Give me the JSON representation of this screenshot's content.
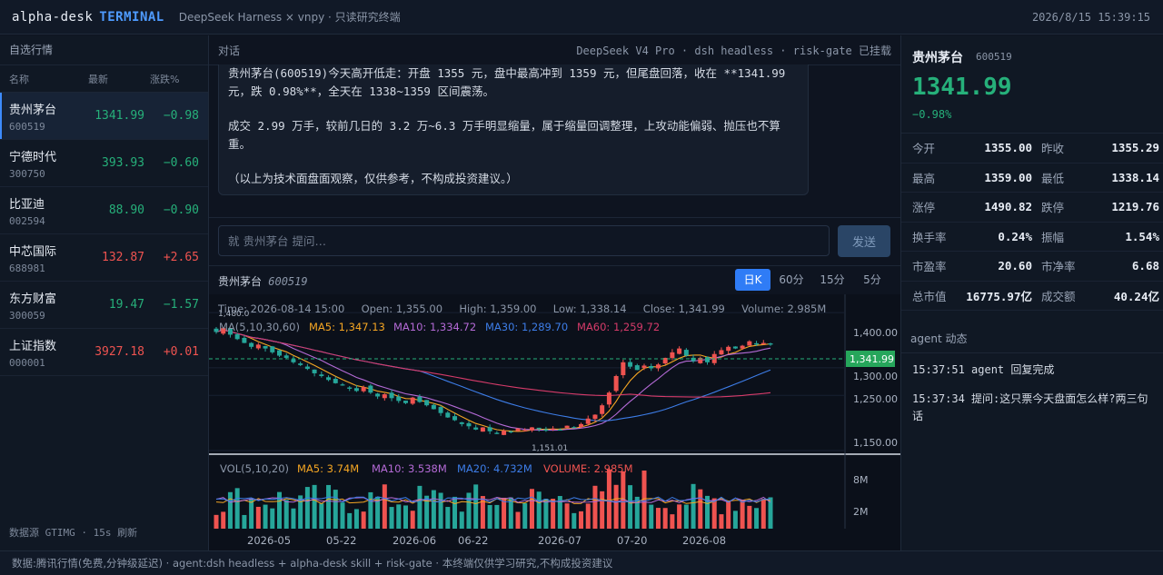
{
  "topbar": {
    "brand": "alpha-desk",
    "brand_accent": "TERMINAL",
    "subtitle": "DeepSeek Harness × vnpy · 只读研究终端",
    "clock": "2026/8/15 15:39:15"
  },
  "watchlist": {
    "title": "自选行情",
    "headers": {
      "name": "名称",
      "last": "最新",
      "pct": "涨跌%"
    },
    "items": [
      {
        "name": "贵州茅台",
        "code": "600519",
        "last": "1341.99",
        "pct": "−0.98",
        "dir": "dn",
        "active": true
      },
      {
        "name": "宁德时代",
        "code": "300750",
        "last": "393.93",
        "pct": "−0.60",
        "dir": "dn"
      },
      {
        "name": "比亚迪",
        "code": "002594",
        "last": "88.90",
        "pct": "−0.90",
        "dir": "dn"
      },
      {
        "name": "中芯国际",
        "code": "688981",
        "last": "132.87",
        "pct": "+2.65",
        "dir": "up"
      },
      {
        "name": "东方财富",
        "code": "300059",
        "last": "19.47",
        "pct": "−1.57",
        "dir": "dn"
      },
      {
        "name": "上证指数",
        "code": "000001",
        "last": "3927.18",
        "pct": "+0.01",
        "dir": "up"
      }
    ],
    "footer": "数据源 GTIMG · 15s 刷新"
  },
  "chat": {
    "title": "对话",
    "model_info": "DeepSeek V4 Pro · dsh headless · risk-gate 已挂载",
    "message_lines": [
      "贵州茅台(600519)今天高开低走：开盘 1355 元，盘中最高冲到 1359 元，但尾盘回落，收在 **1341.99 元，跌 0.98%**，全天在 1338~1359 区间震荡。",
      "成交 2.99 万手，较前几日的 3.2 万~6.3 万手明显缩量，属于缩量回调整理，上攻动能偏弱、抛压也不算重。",
      "（以上为技术面盘面观察，仅供参考，不构成投资建议。）"
    ],
    "input_placeholder": "就 贵州茅台 提问…",
    "send_label": "发送"
  },
  "chart": {
    "symbol_name": "贵州茅台",
    "symbol_code": "600519",
    "timeframes": [
      "日K",
      "60分",
      "15分",
      "5分"
    ],
    "active_timeframe": "日K",
    "info_line": "Time: 2026-08-14 15:00     Open: 1,355.00     High: 1,359.00     Low: 1,338.14     Close: 1,341.99     Volume: 2.985M",
    "ma_legend": {
      "label": "MA(5,10,30,60)",
      "ma5": "MA5: 1,347.13",
      "ma10": "MA10: 1,334.72",
      "ma30": "MA30: 1,289.70",
      "ma60": "MA60: 1,259.72"
    },
    "vol_legend": {
      "label": "VOL(5,10,20)",
      "ma5": "MA5: 3.74M",
      "ma10": "MA10: 3.538M",
      "ma20": "MA20: 4.732M",
      "volume": "VOLUME: 2.985M"
    },
    "price_ticks": [
      "1,400.00",
      "1,300.00",
      "1,250.00",
      "1,150.00"
    ],
    "last_price_label": "1,341.99",
    "high_marker": "1,480.0",
    "low_marker": "1,151.01",
    "vol_ticks": [
      "8M",
      "2M"
    ],
    "date_ticks": [
      "2026-05",
      "05-22",
      "2026-06",
      "06-22",
      "2026-07",
      "07-20",
      "2026-08"
    ],
    "colors": {
      "up": "#ef5350",
      "down": "#26a69a",
      "ma5": "#f5a623",
      "ma10": "#b46ad6",
      "ma30": "#3d7de8",
      "ma60": "#d63b6a"
    }
  },
  "chart_data": {
    "type": "candlestick",
    "title": "贵州茅台 600519 日K",
    "x_range": [
      "2026-04-22",
      "2026-08-14"
    ],
    "ylim": [
      1150,
      1420
    ],
    "close_path": [
      1365,
      1372,
      1360,
      1352,
      1345,
      1338,
      1342,
      1335,
      1328,
      1322,
      1318,
      1310,
      1305,
      1298,
      1290,
      1285,
      1278,
      1272,
      1268,
      1262,
      1258,
      1265,
      1255,
      1248,
      1252,
      1245,
      1240,
      1236,
      1246,
      1238,
      1232,
      1225,
      1218,
      1210,
      1205,
      1198,
      1194,
      1188,
      1192,
      1185,
      1180,
      1186,
      1183,
      1190,
      1187,
      1192,
      1189,
      1186,
      1190,
      1188,
      1195,
      1192,
      1198,
      1208,
      1215,
      1232,
      1255,
      1285,
      1310,
      1302,
      1296,
      1304,
      1299,
      1306,
      1318,
      1328,
      1335,
      1322,
      1312,
      1318,
      1310,
      1325,
      1332,
      1338,
      1335,
      1340,
      1348,
      1342,
      1345,
      1341.99
    ],
    "last": {
      "time": "2026-08-14 15:00",
      "open": 1355.0,
      "high": 1359.0,
      "low": 1338.14,
      "close": 1341.99,
      "volume": "2.985M"
    },
    "ma": {
      "MA5": 1347.13,
      "MA10": 1334.72,
      "MA30": 1289.7,
      "MA60": 1259.72
    },
    "volume_ma": {
      "MA5": "3.74M",
      "MA10": "3.538M",
      "MA20": "4.732M"
    }
  },
  "quote": {
    "name": "贵州茅台",
    "code": "600519",
    "last": "1341.99",
    "pct": "−0.98%",
    "rows": [
      {
        "l1": "今开",
        "v1": "1355.00",
        "l2": "昨收",
        "v2": "1355.29"
      },
      {
        "l1": "最高",
        "v1": "1359.00",
        "l2": "最低",
        "v2": "1338.14"
      },
      {
        "l1": "涨停",
        "v1": "1490.82",
        "l2": "跌停",
        "v2": "1219.76"
      },
      {
        "l1": "换手率",
        "v1": "0.24%",
        "l2": "振幅",
        "v2": "1.54%"
      },
      {
        "l1": "市盈率",
        "v1": "20.60",
        "l2": "市净率",
        "v2": "6.68"
      },
      {
        "l1": "总市值",
        "v1": "16775.97亿",
        "l2": "成交额",
        "v2": "40.24亿"
      }
    ]
  },
  "agent": {
    "title": "agent 动态",
    "logs": [
      "15:37:51 agent 回复完成",
      "15:37:34 提问:这只票今天盘面怎么样?两三句话"
    ]
  },
  "footer": {
    "text": "数据:腾讯行情(免费,分钟级延迟) · agent:dsh headless + alpha-desk skill + risk-gate · 本终端仅供学习研究,不构成投资建议"
  }
}
